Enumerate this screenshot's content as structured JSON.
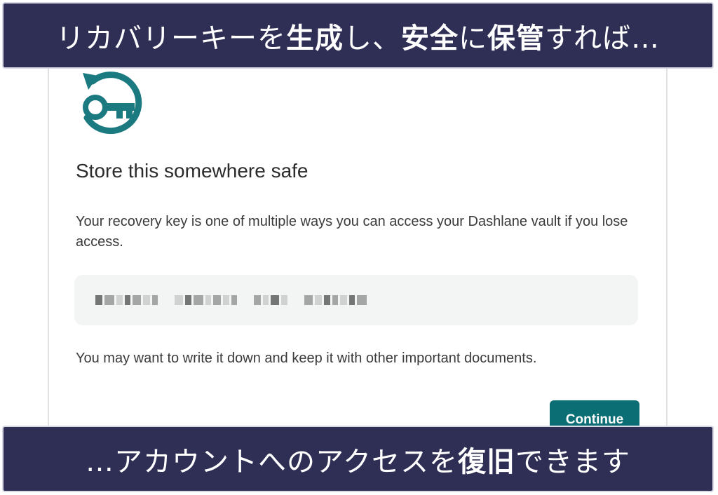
{
  "banner_top": {
    "part1": "リカバリーキーを",
    "bold1": "生成",
    "part2": "し、",
    "bold2": "安全",
    "part3": "に",
    "bold3": "保管",
    "part4": "すれば…"
  },
  "banner_bottom": {
    "part1": "…アカウントへのアクセスを",
    "bold1": "復旧",
    "part2": "できます"
  },
  "dialog": {
    "icon": "recovery-key-icon",
    "title": "Store this somewhere safe",
    "description": "Your recovery key is one of multiple ways you can access your Dashlane vault if you lose access.",
    "note": "You may want to write it down and keep it with other important documents.",
    "continue_label": "Continue"
  },
  "colors": {
    "banner_bg": "#2f2f56",
    "accent": "#0b6e74",
    "icon": "#1b7a80",
    "key_box_bg": "#f3f5f5"
  }
}
